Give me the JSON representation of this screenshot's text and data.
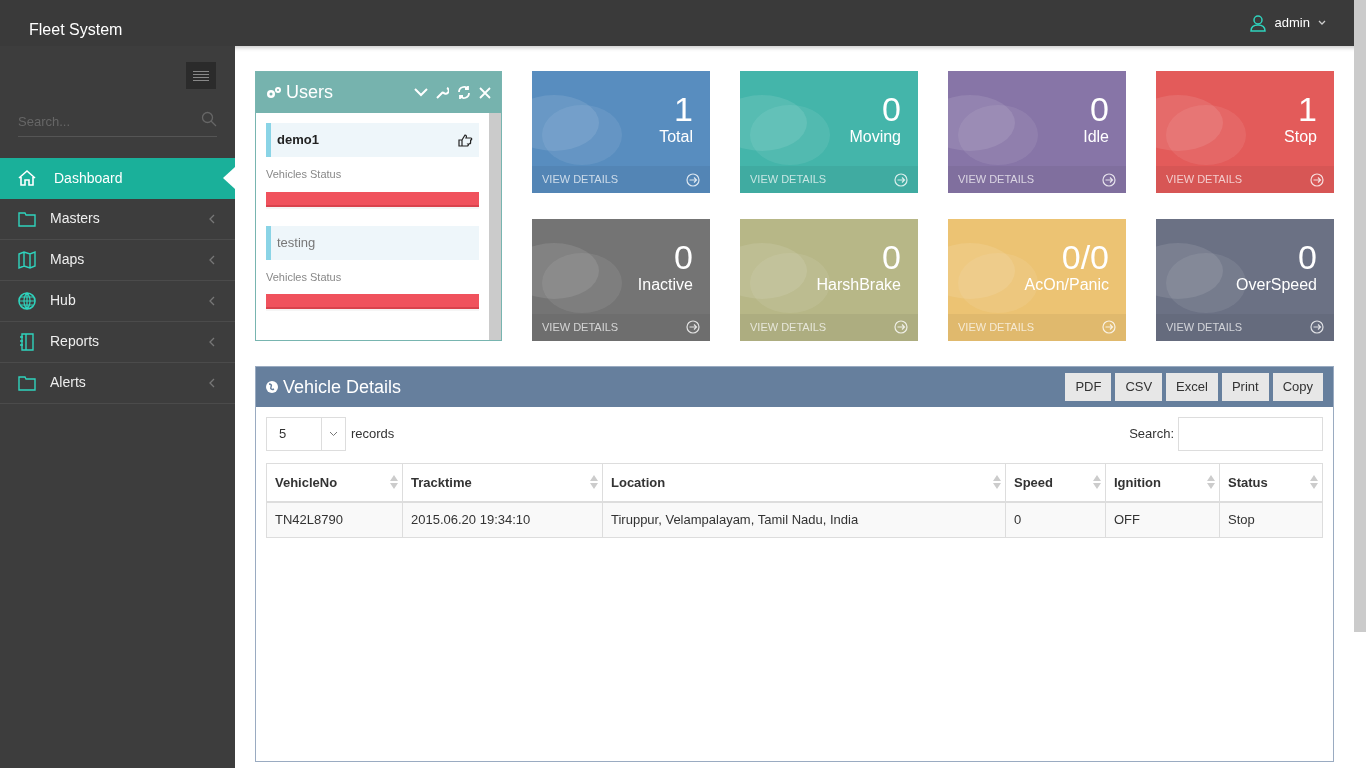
{
  "header": {
    "brand": "Fleet System",
    "user": "admin"
  },
  "sidebar": {
    "search": {
      "placeholder": "Search..."
    },
    "items": [
      {
        "label": "Dashboard",
        "selected": true
      },
      {
        "label": "Masters",
        "selected": false
      },
      {
        "label": "Maps",
        "selected": false
      },
      {
        "label": "Hub",
        "selected": false
      },
      {
        "label": "Reports",
        "selected": false
      },
      {
        "label": "Alerts",
        "selected": false
      }
    ]
  },
  "users_panel": {
    "title": "Users",
    "users": [
      {
        "name": "demo1",
        "selected": true,
        "status_label": "Vehicles Status",
        "level": 1
      },
      {
        "name": "testing",
        "selected": false,
        "status_label": "Vehicles Status",
        "level": 1
      }
    ]
  },
  "tiles": [
    {
      "value": "1",
      "label": "Total",
      "link": "VIEW DETAILS",
      "color": "#588dbf"
    },
    {
      "value": "0",
      "label": "Moving",
      "link": "VIEW DETAILS",
      "color": "#44b5aa"
    },
    {
      "value": "0",
      "label": "Idle",
      "link": "VIEW DETAILS",
      "color": "#8775a7"
    },
    {
      "value": "1",
      "label": "Stop",
      "link": "VIEW DETAILS",
      "color": "#e35b5a"
    },
    {
      "value": "0",
      "label": "Inactive",
      "link": "VIEW DETAILS",
      "color": "#747474"
    },
    {
      "value": "0",
      "label": "HarshBrake",
      "link": "VIEW DETAILS",
      "color": "#b7b787"
    },
    {
      "value": "0/0",
      "label": "AcOn/Panic",
      "link": "VIEW DETAILS",
      "color": "#ecc373"
    },
    {
      "value": "0",
      "label": "OverSpeed",
      "link": "VIEW DETAILS",
      "color": "#6b7184"
    }
  ],
  "vehicle_panel": {
    "title": "Vehicle Details",
    "buttons": [
      "PDF",
      "CSV",
      "Excel",
      "Print",
      "Copy"
    ],
    "page_size": "5",
    "page_size_label": "records",
    "search_label": "Search:",
    "table": {
      "columns": [
        "VehicleNo",
        "Tracktime",
        "Location",
        "Speed",
        "Ignition",
        "Status"
      ],
      "rows": [
        [
          "TN42L8790",
          "2015.06.20 19:34:10",
          "Tiruppur, Velampalayam, Tamil Nadu, India",
          "0",
          "OFF",
          "Stop"
        ]
      ]
    }
  }
}
